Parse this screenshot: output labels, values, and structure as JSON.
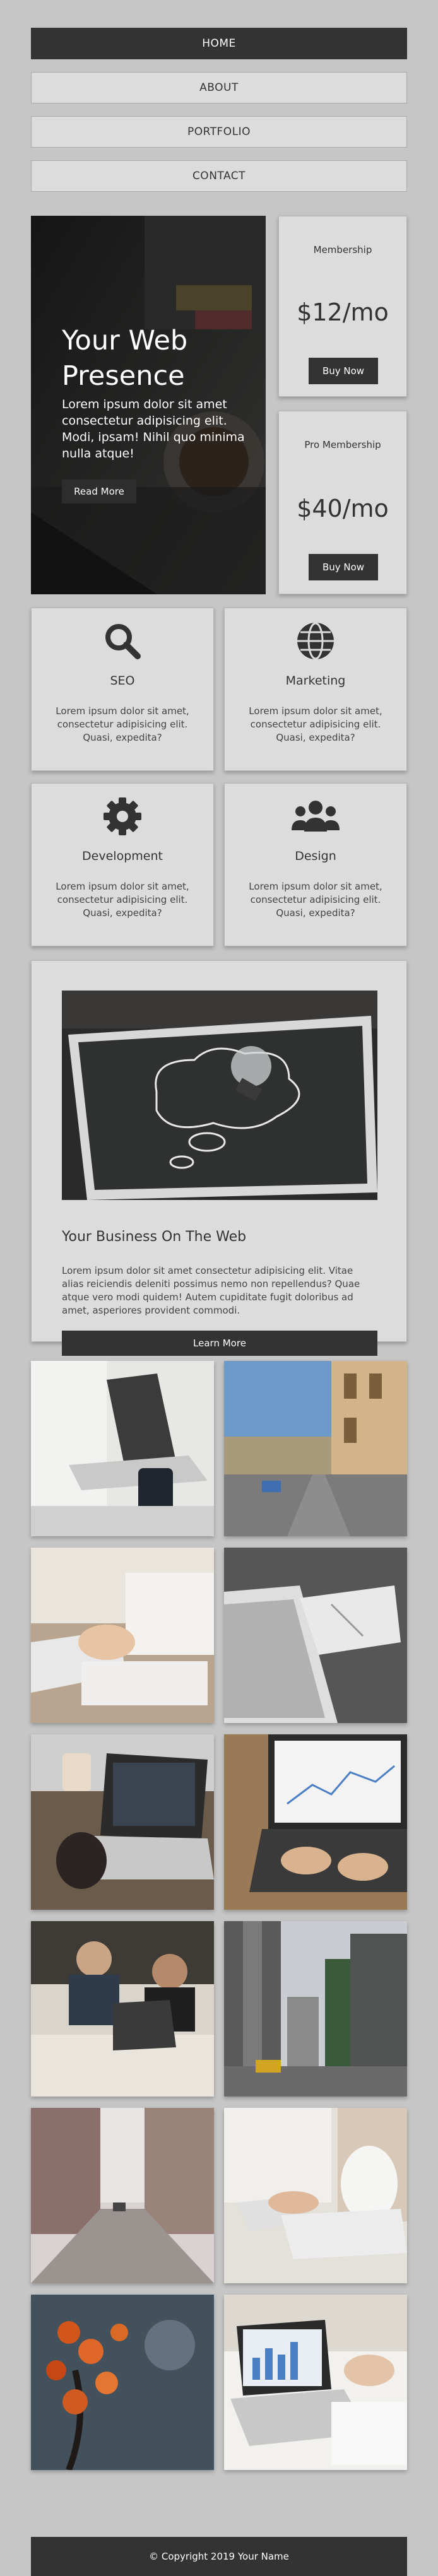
{
  "nav": {
    "items": [
      "HOME",
      "ABOUT",
      "PORTFOLIO",
      "CONTACT"
    ]
  },
  "hero": {
    "title_line1": "Your Web",
    "title_line2": "Presence",
    "text": "Lorem ipsum dolor sit amet consectetur adipisicing elit. Modi, ipsam! Nihil quo minima nulla atque!",
    "button": "Read More"
  },
  "pricing": [
    {
      "title": "Membership",
      "price": "$12/mo",
      "button": "Buy Now"
    },
    {
      "title": "Pro Membership",
      "price": "$40/mo",
      "button": "Buy Now"
    }
  ],
  "features": [
    {
      "icon": "search-icon",
      "title": "SEO",
      "text": "Lorem ipsum dolor sit amet, consectetur adipisicing elit. Quasi, expedita?"
    },
    {
      "icon": "globe-icon",
      "title": "Marketing",
      "text": "Lorem ipsum dolor sit amet, consectetur adipisicing elit. Quasi, expedita?"
    },
    {
      "icon": "gear-icon",
      "title": "Development",
      "text": "Lorem ipsum dolor sit amet, consectetur adipisicing elit. Quasi, expedita?"
    },
    {
      "icon": "users-icon",
      "title": "Design",
      "text": "Lorem ipsum dolor sit amet, consectetur adipisicing elit. Quasi, expedita?"
    }
  ],
  "business": {
    "title": "Your Business On The Web",
    "text": "Lorem ipsum dolor sit amet consectetur adipisicing elit. Vitae alias reiciendis deleniti possimus nemo non repellendus? Quae atque vero modi quidem! Autem cupiditate fugit doloribus ad amet, asperiores provident commodi.",
    "button": "Learn More"
  },
  "footer": {
    "text": "© Copyright 2019 Your Name"
  },
  "colors": {
    "page_bg": "#c6c6c6",
    "card_bg": "#dcdcdc",
    "dark": "#333333"
  }
}
